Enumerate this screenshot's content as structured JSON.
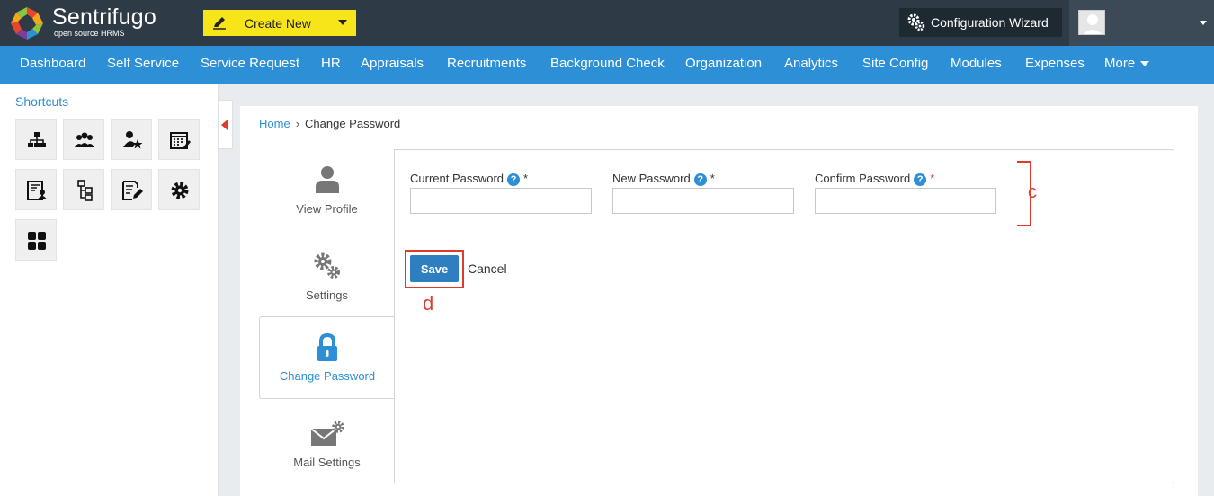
{
  "header": {
    "brand_name": "Sentrifugo",
    "brand_tagline": "open source HRMS",
    "create_new_label": "Create New",
    "config_wizard_label": "Configuration Wizard"
  },
  "nav": {
    "items": [
      "Dashboard",
      "Self Service",
      "Service Request",
      "HR",
      "Appraisals",
      "Recruitments",
      "Background Check",
      "Organization",
      "Analytics",
      "Site Config",
      "Modules",
      "Expenses",
      "More"
    ]
  },
  "sidebar": {
    "title": "Shortcuts",
    "shortcut_icons": [
      "org-chart-icon",
      "group-icon",
      "star-employee-icon",
      "calendar-icon",
      "id-card-icon",
      "hierarchy-icon",
      "edit-document-icon",
      "gear-icon",
      "grid-icon"
    ]
  },
  "breadcrumb": {
    "home": "Home",
    "separator": "›",
    "current": "Change Password"
  },
  "tabs": [
    {
      "label": "View Profile",
      "icon": "user-icon",
      "active": false
    },
    {
      "label": "Settings",
      "icon": "gears-icon",
      "active": false
    },
    {
      "label": "Change Password",
      "icon": "lock-icon",
      "active": true
    },
    {
      "label": "Mail Settings",
      "icon": "mail-settings-icon",
      "active": false
    }
  ],
  "form": {
    "fields": [
      {
        "label": "Current Password",
        "help": "?",
        "required_mark": "*",
        "value": ""
      },
      {
        "label": "New Password",
        "help": "?",
        "required_mark": "*",
        "value": ""
      },
      {
        "label": "Confirm Password",
        "help": "?",
        "required_mark": "*",
        "value": ""
      }
    ],
    "save_label": "Save",
    "cancel_label": "Cancel"
  },
  "annotations": {
    "c": "c",
    "d": "d"
  },
  "colors": {
    "topbar": "#2e3a45",
    "navbar": "#2d8fd5",
    "create_new": "#f7e51a",
    "accent": "#2d8fd5",
    "annotation": "#e03a2c"
  }
}
